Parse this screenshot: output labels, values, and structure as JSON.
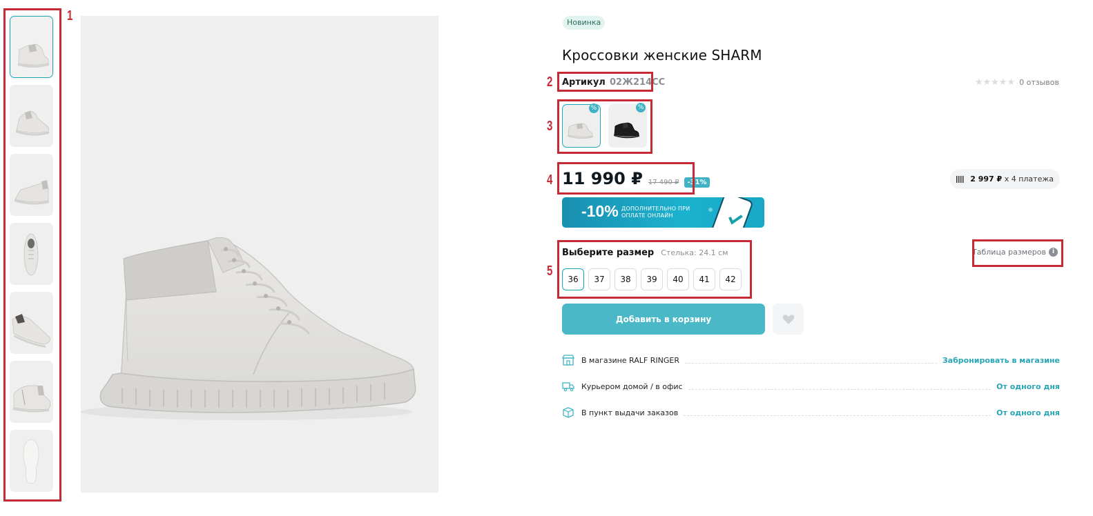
{
  "annotations": [
    "1",
    "2",
    "3",
    "4",
    "5"
  ],
  "gallery": {
    "thumbnails": [
      "Вид сбоку",
      "Вид сбоку 2",
      "Вид сзади",
      "Вид сверху",
      "Вид спереди",
      "Вид изнутри",
      "Подошва"
    ],
    "active_index": 0
  },
  "product": {
    "badge": "Новинка",
    "title": "Кроссовки женские SHARM",
    "sku_label": "Артикул",
    "sku_value": "02Ж214СС",
    "rating_stars": "★★★★★",
    "reviews": "0 отзывов",
    "colors": [
      {
        "name": "светло-серый",
        "badge": "%",
        "swatch": "#d9d8d5"
      },
      {
        "name": "чёрный",
        "badge": "%",
        "swatch": "#1b1b1b"
      }
    ],
    "price": "11 990 ₽",
    "old_price": "17 490 ₽",
    "discount": "-31%",
    "installment_amount": "2 997 ₽",
    "installment_text": "x 4 платежа",
    "promo_big": "-10%",
    "promo_small": "дополнительно при оплате онлайн",
    "size_title": "Выберите размер",
    "insole": "Стелька: 24.1 см",
    "size_table_link": "Таблица размеров",
    "sizes": [
      "36",
      "37",
      "38",
      "39",
      "40",
      "41",
      "42"
    ],
    "selected_size": "36",
    "add_to_cart": "Добавить в корзину"
  },
  "delivery": [
    {
      "label": "В магазине RALF RINGER",
      "link": "Забронировать в магазине",
      "icon": "store-icon"
    },
    {
      "label": "Курьером домой / в офис",
      "link": "От одного дня",
      "icon": "truck-icon"
    },
    {
      "label": "В пункт выдачи заказов",
      "link": "От одного дня",
      "icon": "box-icon"
    }
  ],
  "colors": {
    "accent": "#3fb3c4",
    "annotation": "#c62a35",
    "link": "#27a5b5"
  }
}
